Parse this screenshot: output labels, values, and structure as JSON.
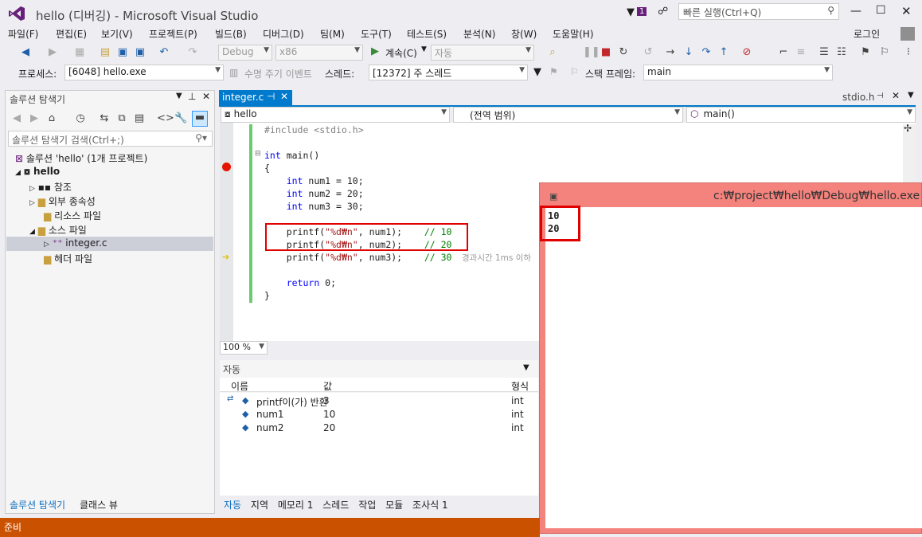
{
  "window": {
    "title": "hello (디버깅) - Microsoft Visual Studio",
    "notification_count": "1",
    "quick_launch_placeholder": "빠른 실행(Ctrl+Q)",
    "signin": "로그인"
  },
  "menu": [
    "파일(F)",
    "편집(E)",
    "보기(V)",
    "프로젝트(P)",
    "빌드(B)",
    "디버그(D)",
    "팀(M)",
    "도구(T)",
    "테스트(S)",
    "분석(N)",
    "창(W)",
    "도움말(H)"
  ],
  "toolbar": {
    "config": "Debug",
    "platform": "x86",
    "continue_label": "계속(C)",
    "auto": "자동"
  },
  "debug_bar": {
    "process_label": "프로세스:",
    "process": "[6048] hello.exe",
    "lifecycle": "수명 주기 이벤트",
    "thread_label": "스레드:",
    "thread": "[12372] 주 스레드",
    "stack_label": "스택 프레임:",
    "stack": "main"
  },
  "solution_explorer": {
    "title": "솔루션 탐색기",
    "search_placeholder": "솔루션 탐색기 검색(Ctrl+;)",
    "solution": "솔루션 'hello' (1개 프로젝트)",
    "project": "hello",
    "nodes": [
      "참조",
      "외부 종속성",
      "리소스 파일",
      "소스 파일",
      "integer.c",
      "헤더 파일"
    ],
    "bottom_tabs": [
      "솔루션 탐색기",
      "클래스 뷰"
    ]
  },
  "editor": {
    "active_tab": "integer.c",
    "right_tab": "stdio.h",
    "nav_project": "hello",
    "nav_scope": "(전역 범위)",
    "nav_member": "main()",
    "zoom": "100 %",
    "lines": [
      "#include <stdio.h>",
      "",
      "int main()",
      "{",
      "    int num1 = 10;",
      "    int num2 = 20;",
      "    int num3 = 30;",
      "",
      "    printf(\"%d₩n\", num1);    // 10",
      "    printf(\"%d₩n\", num2);    // 20",
      "    printf(\"%d₩n\", num3);    // 30",
      "",
      "    return 0;",
      "}"
    ],
    "perf_tip": "경과시간 1ms 이하"
  },
  "autos": {
    "title": "자동",
    "columns": [
      "이름",
      "값",
      "형식"
    ],
    "rows": [
      [
        "printf이(가) 반환",
        "3",
        "int"
      ],
      [
        "num1",
        "10",
        "int"
      ],
      [
        "num2",
        "20",
        "int"
      ]
    ],
    "bottom_tabs": [
      "자동",
      "지역",
      "메모리 1",
      "스레드",
      "작업",
      "모듈",
      "조사식 1"
    ]
  },
  "console": {
    "title": "c:₩project₩hello₩Debug₩hello.exe",
    "output": [
      "10",
      "20"
    ]
  },
  "status": "준비"
}
